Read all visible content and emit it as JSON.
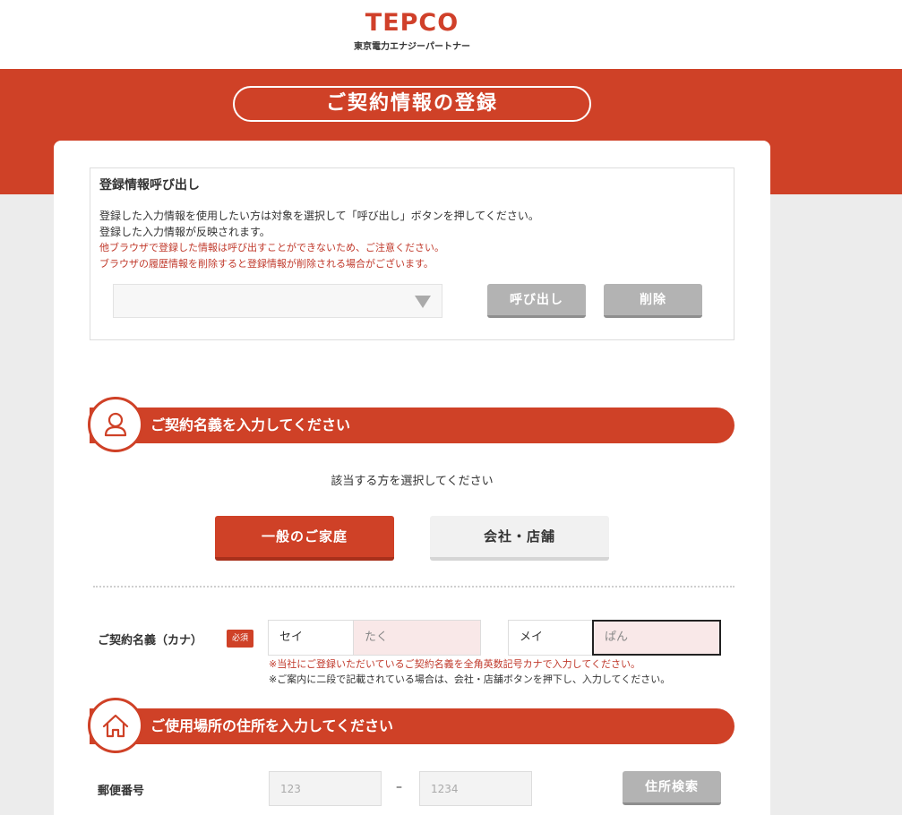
{
  "header": {
    "logo_text": "TEPCO",
    "logo_subtext": "東京電力エナジーパートナー"
  },
  "page_title": "ご契約情報の登録",
  "recall": {
    "title": "登録情報呼び出し",
    "desc1": "登録した入力情報を使用したい方は対象を選択して「呼び出し」ボタンを押してください。",
    "desc2": "登録した入力情報が反映されます。",
    "note1": "他ブラウザで登録した情報は呼び出すことができないため、ご注意ください。",
    "note2": "ブラウザの履歴情報を削除すると登録情報が削除される場合がございます。",
    "select_value": "",
    "call_button": "呼び出し",
    "delete_button": "削除"
  },
  "contract_section": {
    "heading": "ご契約名義を入力してください",
    "prompt": "該当する方を選択してください",
    "tabs": [
      {
        "label": "一般のご家庭",
        "active": true
      },
      {
        "label": "会社・店舗",
        "active": false
      }
    ]
  },
  "name_field": {
    "label": "ご契約名義（カナ）",
    "required_badge": "必須",
    "sei_label": "セイ",
    "sei_value": "たく",
    "mei_label": "メイ",
    "mei_value": "ぱん",
    "note_red": "※当社にご登録いただいているご契約名義を全角英数記号カナで入力してください。",
    "note_black": "※ご案内に二段で記載されている場合は、会社・店舗ボタンを押下し、入力してください。"
  },
  "address_section": {
    "heading": "ご使用場所の住所を入力してください"
  },
  "postal_field": {
    "label": "郵便番号",
    "placeholder1": "123",
    "separator": "–",
    "placeholder2": "1234",
    "search_button": "住所検索"
  },
  "colors": {
    "brand": "#cf4127",
    "button_gray": "#b3b3b3"
  }
}
